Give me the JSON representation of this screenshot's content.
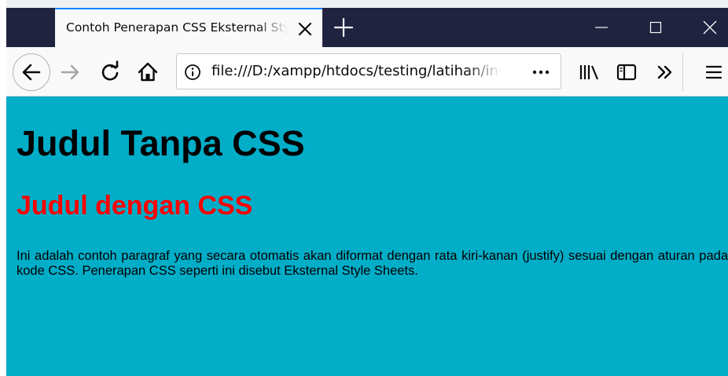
{
  "browser": {
    "tab": {
      "title": "Contoh Penerapan CSS Eksternal Style Sheets"
    },
    "url": "file:///D:/xampp/htdocs/testing/latihan/index.html",
    "colors": {
      "tabbar": "#202340",
      "active_tab_accent": "#0a84ff",
      "toolbar": "#f9f9fa"
    },
    "icons": {
      "tab_close": "close-icon",
      "new_tab": "plus-icon",
      "window": [
        "minimize-icon",
        "maximize-icon",
        "close-icon"
      ],
      "nav": [
        "back-arrow-icon",
        "forward-arrow-icon",
        "reload-icon",
        "home-icon"
      ],
      "url": [
        "info-icon",
        "page-actions-icon"
      ],
      "toolbar": [
        "library-icon",
        "sidebar-icon",
        "overflow-chevron-icon",
        "menu-icon"
      ]
    }
  },
  "page": {
    "background": "#02adc8",
    "heading_plain": "Judul Tanpa CSS",
    "heading_styled": "Judul dengan CSS",
    "heading_styled_color": "#ff0000",
    "paragraph": "Ini adalah contoh paragraf yang secara otomatis akan diformat dengan rata kiri-kanan (justify) sesuai dengan aturan pada kode CSS. Penerapan CSS seperti ini disebut Eksternal Style Sheets."
  }
}
